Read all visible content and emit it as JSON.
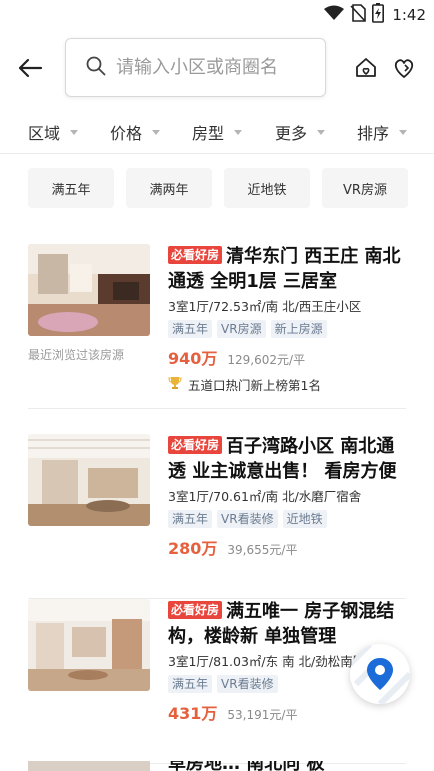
{
  "status_bar": {
    "time": "1:42",
    "icons": [
      "wifi-icon",
      "no-sim-icon",
      "battery-charging-icon"
    ]
  },
  "header": {
    "back_icon": "arrow-left-icon",
    "search_placeholder": "请输入小区或商圈名",
    "search_icon": "search-icon",
    "icons": [
      "house-heart-icon",
      "heart-flag-icon"
    ]
  },
  "filters": [
    {
      "label": "区域"
    },
    {
      "label": "价格"
    },
    {
      "label": "房型"
    },
    {
      "label": "更多"
    },
    {
      "label": "排序"
    }
  ],
  "quick_tags": [
    "满五年",
    "满两年",
    "近地铁",
    "VR房源"
  ],
  "listings": [
    {
      "badge": "必看好房",
      "title": "清华东门 西王庄 南北通透 全明1层 三居室",
      "meta": "3室1厅/72.53㎡/南 北/西王庄小区",
      "tags": [
        "满五年",
        "VR房源",
        "新上房源"
      ],
      "price": "940万",
      "unit_price": "129,602元/平",
      "recent_note": "最近浏览过该房源",
      "rank": "五道口热门新上榜第1名"
    },
    {
      "badge": "必看好房",
      "title": "百子湾路小区 南北通透 业主诚意出售！ 看房方便",
      "meta": "3室1厅/70.61㎡/南 北/水磨厂宿舍",
      "tags": [
        "满五年",
        "VR看装修",
        "近地铁"
      ],
      "price": "280万",
      "unit_price": "39,655元/平"
    },
    {
      "badge": "必看好房",
      "title": "满五唯一 房子钢混结构，楼龄新 单独管理",
      "meta": "3室1厅/81.03㎡/东 南 北/劲松南路",
      "tags": [
        "满五年",
        "VR看装修"
      ],
      "price": "431万",
      "unit_price": "53,191元/平"
    }
  ],
  "partial_title": "草房地… 南北向 板",
  "map_fab_icon": "map-pin-icon",
  "colors": {
    "accent": "#e5603f",
    "badge": "#e8453c",
    "tag_bg": "#eef1f5",
    "pin": "#1b6bd9"
  }
}
